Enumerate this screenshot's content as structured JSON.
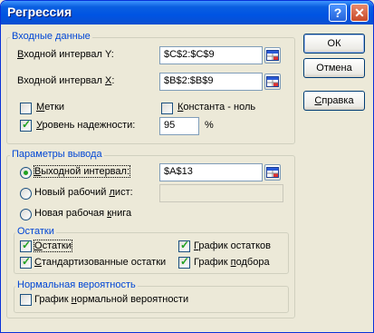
{
  "window": {
    "title": "Регрессия",
    "help_glyph": "?",
    "close_glyph": "✕"
  },
  "input_group": {
    "label": "Входные данные",
    "y_range_label_pre": "",
    "y_range_label_u": "В",
    "y_range_label_post": "ходной интервал Y:",
    "y_range_value": "$C$2:$C$9",
    "x_range_label_pre": "Входной интервал ",
    "x_range_label_u": "X",
    "x_range_label_post": ":",
    "x_range_value": "$B$2:$B$9",
    "labels_pre": "",
    "labels_u": "М",
    "labels_post": "етки",
    "labels_checked": false,
    "constant_pre": "",
    "constant_u": "К",
    "constant_post": "онстанта - ноль",
    "constant_checked": false,
    "confidence_pre": "",
    "confidence_u": "У",
    "confidence_post": "ровень надежности:",
    "confidence_checked": true,
    "confidence_value": "95",
    "percent": "%"
  },
  "output_group": {
    "label": "Параметры вывода",
    "output_range_pre": "",
    "output_range_u": "В",
    "output_range_post": "ыходной интервал:",
    "output_range_value": "$A$13",
    "new_sheet_pre": "Новый рабочий ",
    "new_sheet_u": "л",
    "new_sheet_post": "ист:",
    "new_sheet_value": "",
    "new_book_pre": "Новая рабочая ",
    "new_book_u": "к",
    "new_book_post": "нига",
    "selected": "output_range"
  },
  "residuals_group": {
    "label": "Остатки",
    "residuals_pre": "",
    "residuals_u": "О",
    "residuals_post": "статки",
    "std_residuals_pre": "",
    "std_residuals_u": "С",
    "std_residuals_post": "тандартизованные остатки",
    "residual_plot_pre": "",
    "residual_plot_u": "Г",
    "residual_plot_post": "рафик остатков",
    "fit_plot_pre": "График ",
    "fit_plot_u": "п",
    "fit_plot_post": "одбора",
    "residuals_checked": true,
    "std_residuals_checked": true,
    "residual_plot_checked": true,
    "fit_plot_checked": true
  },
  "normal_group": {
    "label": "Нормальная вероятность",
    "plot_pre": "График ",
    "plot_u": "н",
    "plot_post": "ормальной вероятности",
    "plot_checked": false
  },
  "buttons": {
    "ok": "ОК",
    "cancel": "Отмена",
    "help_pre": "",
    "help_u": "С",
    "help_post": "правка"
  },
  "icons": {
    "range_picker": "range-picker-icon"
  },
  "colors": {
    "titlebar": "#0054E3",
    "group_label": "#0046D5",
    "check_mark": "#21A121",
    "dialog_bg": "#ECE9D8"
  }
}
